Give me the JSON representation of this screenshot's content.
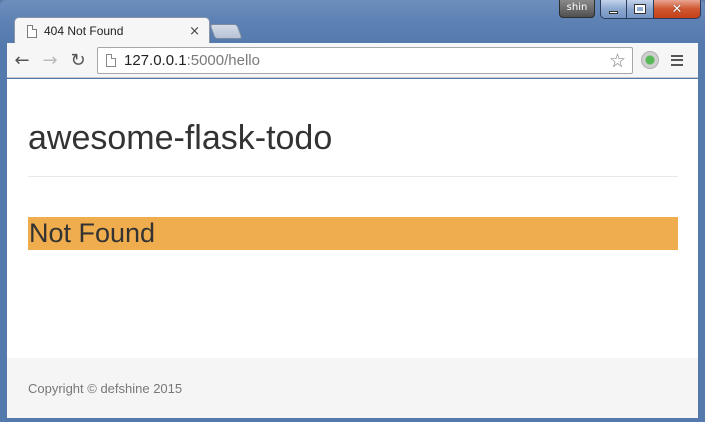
{
  "browser": {
    "tab": {
      "title": "404 Not Found",
      "close_glyph": "×"
    },
    "user_badge": "shin",
    "caption": {
      "minimize": "minimize-icon",
      "maximize": "maximize-icon",
      "close": "✕"
    },
    "nav": {
      "back": "←",
      "forward": "→",
      "reload": "↻"
    },
    "url": {
      "host": "127.0.0.1",
      "rest": ":5000/hello"
    },
    "star_glyph": "☆"
  },
  "page": {
    "site_title": "awesome-flask-todo",
    "alert_text": "Not Found",
    "footer_text": "Copyright © defshine 2015"
  },
  "colors": {
    "alert_bg": "#f0ad4e",
    "footer_bg": "#f5f5f5",
    "text": "#333333"
  }
}
